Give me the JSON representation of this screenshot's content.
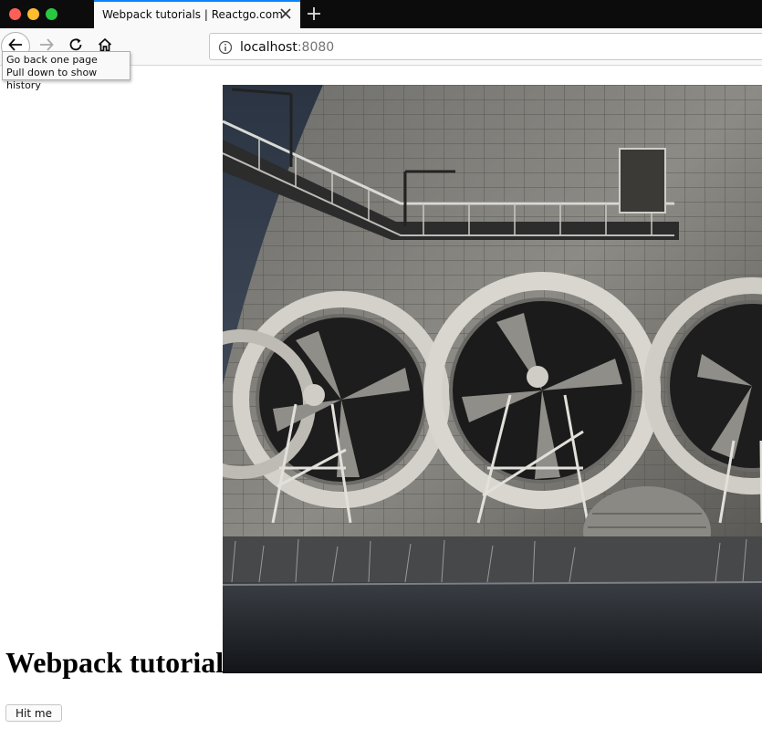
{
  "browser": {
    "tab": {
      "title": "Webpack tutorials | Reactgo.com",
      "close_icon": "close-icon"
    },
    "new_tab_icon": "plus-icon",
    "nav": {
      "back_icon": "arrow-left-icon",
      "forward_icon": "arrow-right-icon",
      "reload_icon": "reload-icon",
      "home_icon": "home-icon"
    },
    "url": {
      "host": "localhost",
      "port": ":8080",
      "info_icon": "info-icon"
    },
    "tooltip": {
      "line1": "Go back one page",
      "line2": "Pull down to show history"
    }
  },
  "page": {
    "image_alt": "industrial cooling tower with large fans",
    "heading": "Webpack tutorial",
    "button_label": "Hit me"
  },
  "colors": {
    "tabbar": "#0c0c0d",
    "tab_accent": "#0a84ff",
    "toolbar": "#f9f9fa"
  }
}
